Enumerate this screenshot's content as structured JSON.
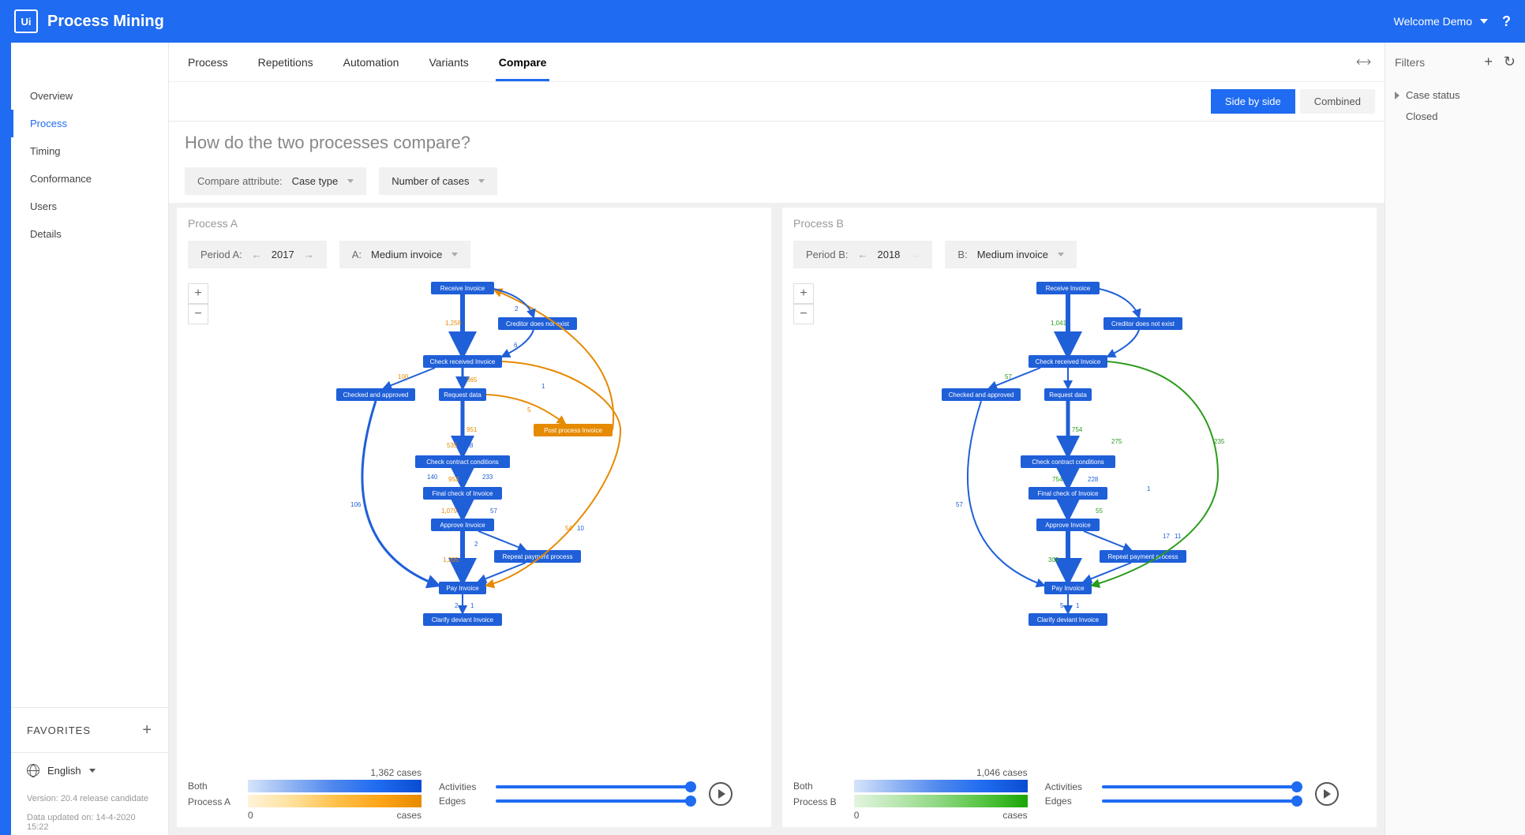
{
  "header": {
    "app_title": "Process Mining",
    "user_label": "Welcome Demo",
    "help": "?"
  },
  "sidebar": {
    "items": [
      {
        "label": "Overview"
      },
      {
        "label": "Process"
      },
      {
        "label": "Timing"
      },
      {
        "label": "Conformance"
      },
      {
        "label": "Users"
      },
      {
        "label": "Details"
      }
    ],
    "favorites_label": "FAVORITES",
    "language_label": "English",
    "version_label": "Version: 20.4 release candidate",
    "data_updated_label": "Data updated on: 14-4-2020 15:22"
  },
  "tabs": [
    {
      "label": "Process"
    },
    {
      "label": "Repetitions"
    },
    {
      "label": "Automation"
    },
    {
      "label": "Variants"
    },
    {
      "label": "Compare"
    }
  ],
  "viewmode": {
    "side_by_side": "Side by side",
    "combined": "Combined"
  },
  "page": {
    "title": "How do the two processes compare?",
    "compare_attr_label": "Compare attribute:",
    "compare_attr_value": "Case type",
    "metric_value": "Number of cases"
  },
  "process_a": {
    "title": "Process A",
    "period_label": "Period A:",
    "period_value": "2017",
    "attr_label": "A:",
    "attr_value": "Medium invoice",
    "total_cases": "1,362 cases",
    "legend_rows": [
      "Both",
      "Process A"
    ],
    "legend_min": "0",
    "legend_unit": "cases",
    "nodes": [
      {
        "label": "Receive Invoice"
      },
      {
        "label": "Creditor does not exist"
      },
      {
        "label": "Check received Invoice"
      },
      {
        "label": "Checked and approved"
      },
      {
        "label": "Request data"
      },
      {
        "label": "Post process Invoice"
      },
      {
        "label": "Check contract conditions"
      },
      {
        "label": "Final check of Invoice"
      },
      {
        "label": "Approve Invoice"
      },
      {
        "label": "Repeat payment process"
      },
      {
        "label": "Pay Invoice"
      },
      {
        "label": "Clarify deviant Invoice"
      }
    ],
    "edge_values": {
      "e1": "1,258",
      "e2": "365",
      "e3": "100",
      "e4": "951",
      "e5": "535",
      "e6": "358",
      "e7": "953",
      "e8": "140",
      "e9": "233",
      "e10": "1,079",
      "e11": "57",
      "e12": "1,205",
      "e13": "106",
      "e14": "2",
      "e15": "1",
      "e16": "5",
      "e17": "1",
      "e18": "54",
      "e19": "10",
      "e20": "6",
      "e21": "2",
      "e22": "1"
    }
  },
  "process_b": {
    "title": "Process B",
    "period_label": "Period B:",
    "period_value": "2018",
    "attr_label": "B:",
    "attr_value": "Medium invoice",
    "total_cases": "1,046 cases",
    "legend_rows": [
      "Both",
      "Process B"
    ],
    "legend_min": "0",
    "legend_unit": "cases",
    "nodes": [
      {
        "label": "Receive Invoice"
      },
      {
        "label": "Creditor does not exist"
      },
      {
        "label": "Check received Invoice"
      },
      {
        "label": "Checked and approved"
      },
      {
        "label": "Request data"
      },
      {
        "label": "Check contract conditions"
      },
      {
        "label": "Final check of Invoice"
      },
      {
        "label": "Approve Invoice"
      },
      {
        "label": "Repeat payment process"
      },
      {
        "label": "Pay Invoice"
      },
      {
        "label": "Clarify deviant Invoice"
      }
    ],
    "edge_values": {
      "e1": "1,041",
      "e2": "57",
      "e3": "754",
      "e4": "275",
      "e5": "754",
      "e6": "228",
      "e7": "55",
      "e8": "309",
      "e9": "57",
      "e10": "235",
      "e11": "17",
      "e12": "11",
      "e13": "1",
      "e14": "5",
      "e15": "1"
    }
  },
  "sliders": {
    "activities": "Activities",
    "edges": "Edges"
  },
  "right_panel": {
    "title": "Filters",
    "case_status": "Case status",
    "closed": "Closed"
  }
}
